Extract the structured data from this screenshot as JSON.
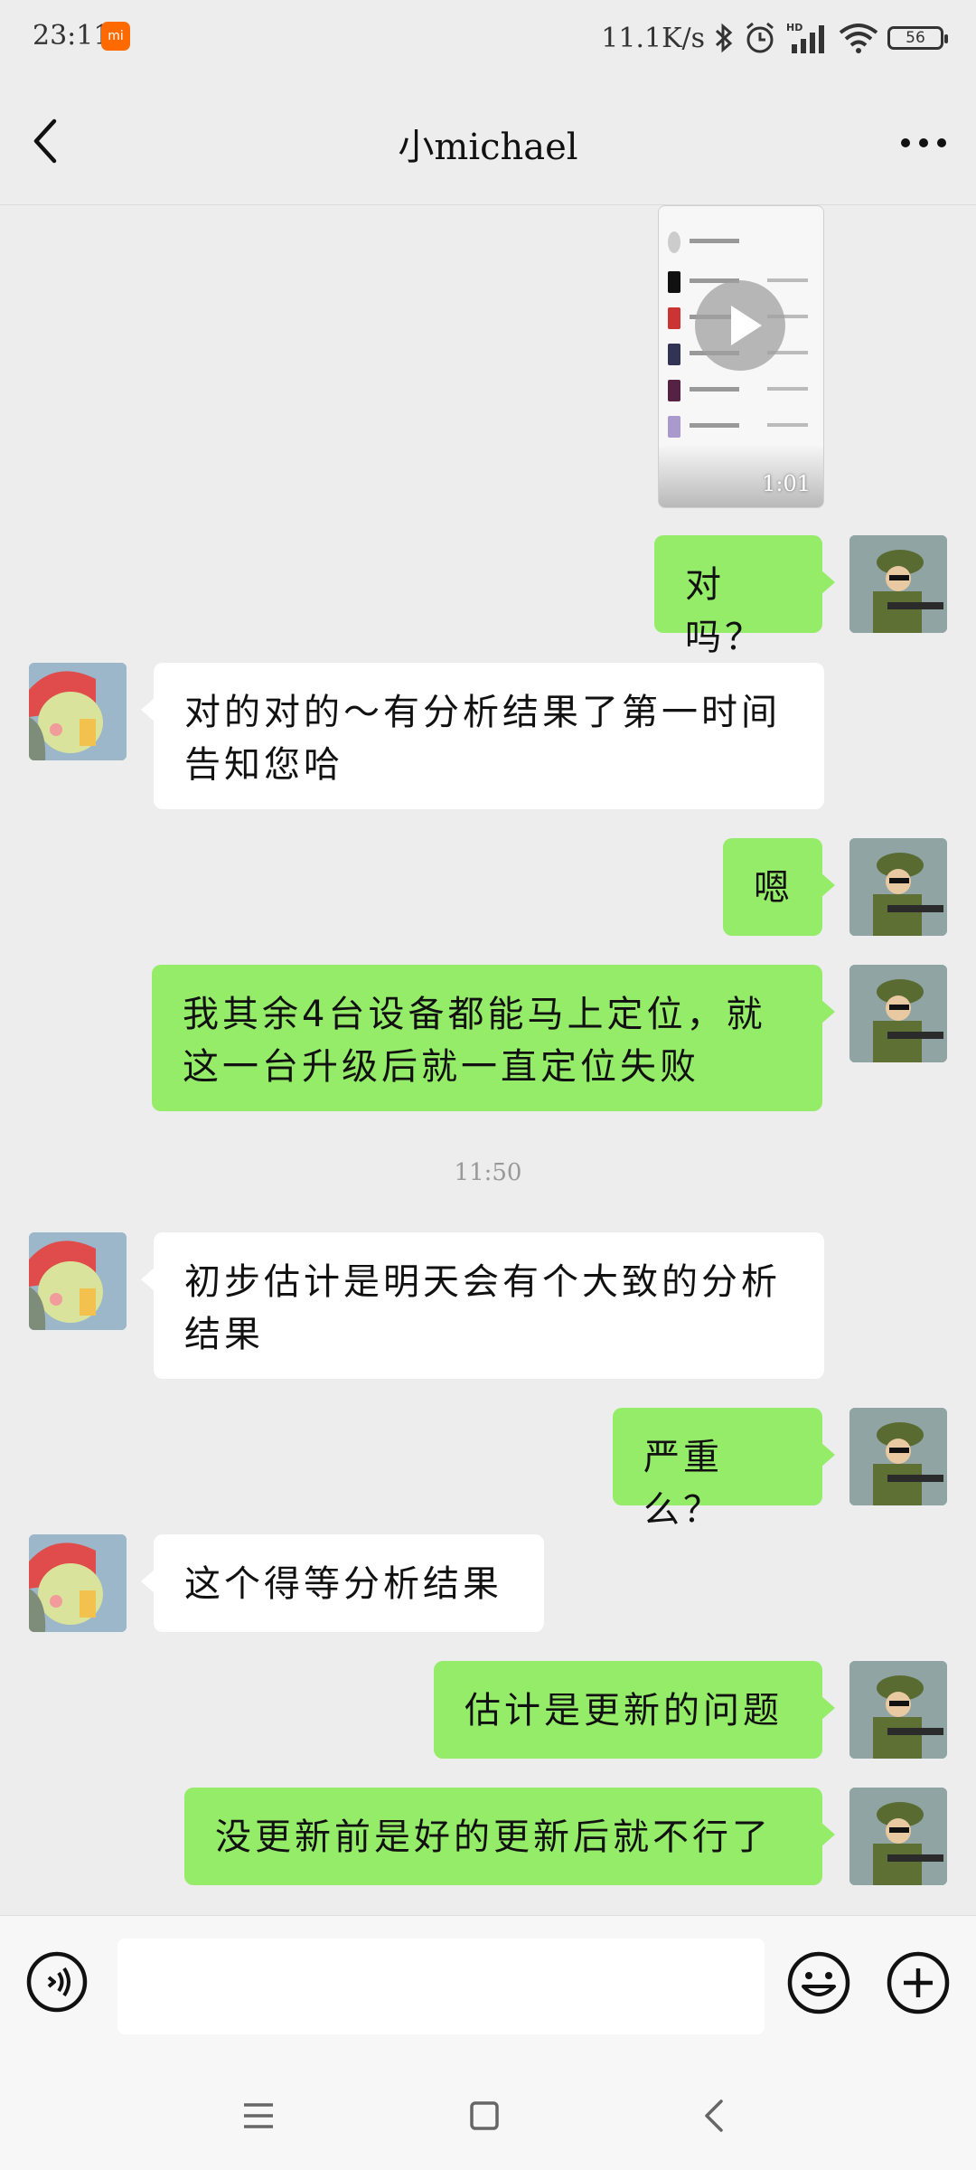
{
  "status_bar": {
    "time": "23:11",
    "app_badge": "mi",
    "net_speed": "11.1K/s",
    "network": "HD",
    "battery": "56"
  },
  "header": {
    "title": "小michael"
  },
  "video": {
    "duration": "1:01"
  },
  "messages": [
    {
      "from": "me",
      "text": "对吗？"
    },
    {
      "from": "other",
      "text": "对的对的～有分析结果了第一时间告知您哈"
    },
    {
      "from": "me",
      "text": "嗯"
    },
    {
      "from": "me",
      "text": "我其余4台设备都能马上定位，就这一台升级后就一直定位失败"
    },
    {
      "from": "other",
      "text": "初步估计是明天会有个大致的分析结果"
    },
    {
      "from": "me",
      "text": "严重么？"
    },
    {
      "from": "other",
      "text": "这个得等分析结果"
    },
    {
      "from": "me",
      "text": "估计是更新的问题"
    },
    {
      "from": "me",
      "text": "没更新前是好的更新后就不行了"
    }
  ],
  "timestamp": "11:50",
  "input": {
    "value": "",
    "placeholder": ""
  },
  "icons": {
    "back": "back-arrow-icon",
    "more": "more-dots-icon",
    "voice": "voice-icon",
    "emoji": "emoji-icon",
    "plus": "plus-icon"
  },
  "colors": {
    "my_bubble": "#95ec69",
    "other_bubble": "#ffffff",
    "background": "#ededed"
  }
}
